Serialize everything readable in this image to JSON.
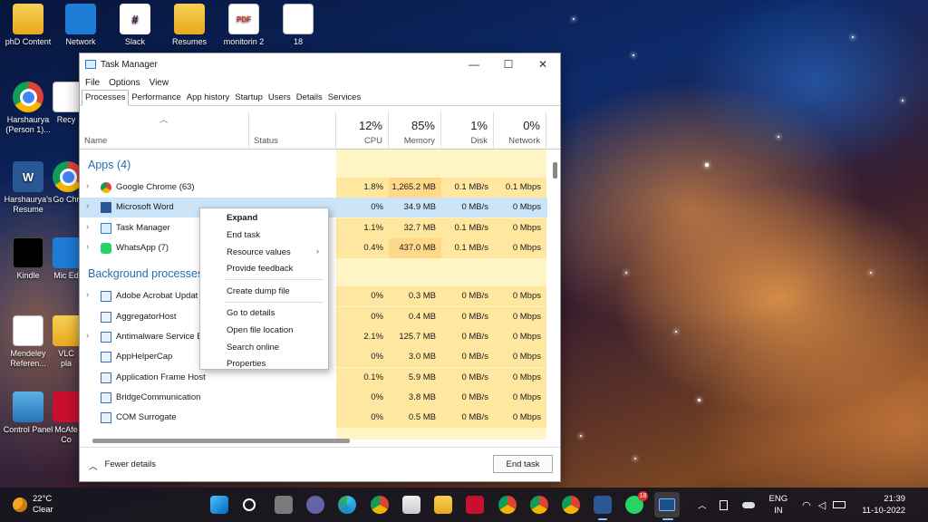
{
  "desktop": {
    "icons": [
      {
        "label": "phD Content",
        "icon": "folder-icon"
      },
      {
        "label": "Network",
        "icon": "network-icon"
      },
      {
        "label": "Slack",
        "icon": "slack-icon"
      },
      {
        "label": "Resumes",
        "icon": "folder-icon"
      },
      {
        "label": "monitorin 2",
        "icon": "pdf-icon",
        "glyph": "PDF"
      },
      {
        "label": "18",
        "icon": "document-icon"
      },
      {
        "label": "Harshaurya (Person 1)...",
        "icon": "chrome-icon"
      },
      {
        "label": "Recy",
        "icon": "recycle-bin-icon"
      },
      {
        "label": "Harshaurya's Resume",
        "icon": "word-icon",
        "glyph": "W"
      },
      {
        "label": "Go Chr",
        "icon": "chrome-icon"
      },
      {
        "label": "Kindle",
        "icon": "kindle-icon"
      },
      {
        "label": "Mic Ed",
        "icon": "edge-icon"
      },
      {
        "label": "Mendeley Referen...",
        "icon": "document-icon"
      },
      {
        "label": "VLC pla",
        "icon": "vlc-icon"
      },
      {
        "label": "Control Panel",
        "icon": "control-panel-icon"
      },
      {
        "label": "McAfe Co",
        "icon": "mcafee-icon"
      }
    ]
  },
  "window": {
    "title": "Task Manager",
    "controls": {
      "minimize": "—",
      "maximize": "☐",
      "close": "✕"
    },
    "menu": [
      "File",
      "Options",
      "View"
    ],
    "tabs": [
      "Processes",
      "Performance",
      "App history",
      "Startup",
      "Users",
      "Details",
      "Services"
    ],
    "columns": {
      "name": "Name",
      "status": "Status",
      "cpu": {
        "pct": "12%",
        "label": "CPU"
      },
      "memory": {
        "pct": "85%",
        "label": "Memory"
      },
      "disk": {
        "pct": "1%",
        "label": "Disk"
      },
      "network": {
        "pct": "0%",
        "label": "Network"
      }
    },
    "sections": {
      "apps": "Apps (4)",
      "background": "Background processes"
    },
    "apps": [
      {
        "name": "Google Chrome (63)",
        "cpu": "1.8%",
        "mem": "1,265.2 MB",
        "disk": "0.1 MB/s",
        "net": "0.1 Mbps",
        "icon": "chrome-icon"
      },
      {
        "name": "Microsoft Word",
        "cpu": "0%",
        "mem": "34.9 MB",
        "disk": "0 MB/s",
        "net": "0 Mbps",
        "icon": "word-icon"
      },
      {
        "name": "Task Manager",
        "cpu": "1.1%",
        "mem": "32.7 MB",
        "disk": "0.1 MB/s",
        "net": "0 Mbps",
        "icon": "task-manager-icon"
      },
      {
        "name": "WhatsApp (7)",
        "cpu": "0.4%",
        "mem": "437.0 MB",
        "disk": "0.1 MB/s",
        "net": "0 Mbps",
        "icon": "whatsapp-icon"
      }
    ],
    "background": [
      {
        "name": "Adobe Acrobat Updat",
        "cpu": "0%",
        "mem": "0.3 MB",
        "disk": "0 MB/s",
        "net": "0 Mbps"
      },
      {
        "name": "AggregatorHost",
        "cpu": "0%",
        "mem": "0.4 MB",
        "disk": "0 MB/s",
        "net": "0 Mbps"
      },
      {
        "name": "Antimalware Service E",
        "cpu": "2.1%",
        "mem": "125.7 MB",
        "disk": "0 MB/s",
        "net": "0 Mbps"
      },
      {
        "name": "AppHelperCap",
        "cpu": "0%",
        "mem": "3.0 MB",
        "disk": "0 MB/s",
        "net": "0 Mbps"
      },
      {
        "name": "Application Frame Host",
        "cpu": "0.1%",
        "mem": "5.9 MB",
        "disk": "0 MB/s",
        "net": "0 Mbps"
      },
      {
        "name": "BridgeCommunication",
        "cpu": "0%",
        "mem": "3.8 MB",
        "disk": "0 MB/s",
        "net": "0 Mbps"
      },
      {
        "name": "COM Surrogate",
        "cpu": "0%",
        "mem": "0.5 MB",
        "disk": "0 MB/s",
        "net": "0 Mbps"
      }
    ],
    "footer": {
      "fewer_details": "Fewer details",
      "end_task": "End task"
    }
  },
  "context_menu": {
    "expand": "Expand",
    "end_task": "End task",
    "resource_values": "Resource values",
    "provide_feedback": "Provide feedback",
    "create_dump": "Create dump file",
    "go_to_details": "Go to details",
    "open_file_location": "Open file location",
    "search_online": "Search online",
    "properties": "Properties"
  },
  "taskbar": {
    "weather": {
      "temp": "22°C",
      "condition": "Clear"
    },
    "tray": {
      "language": "ENG",
      "region": "IN",
      "time": "21:39",
      "date": "11-10-2022"
    },
    "whatsapp_badge": "18"
  }
}
